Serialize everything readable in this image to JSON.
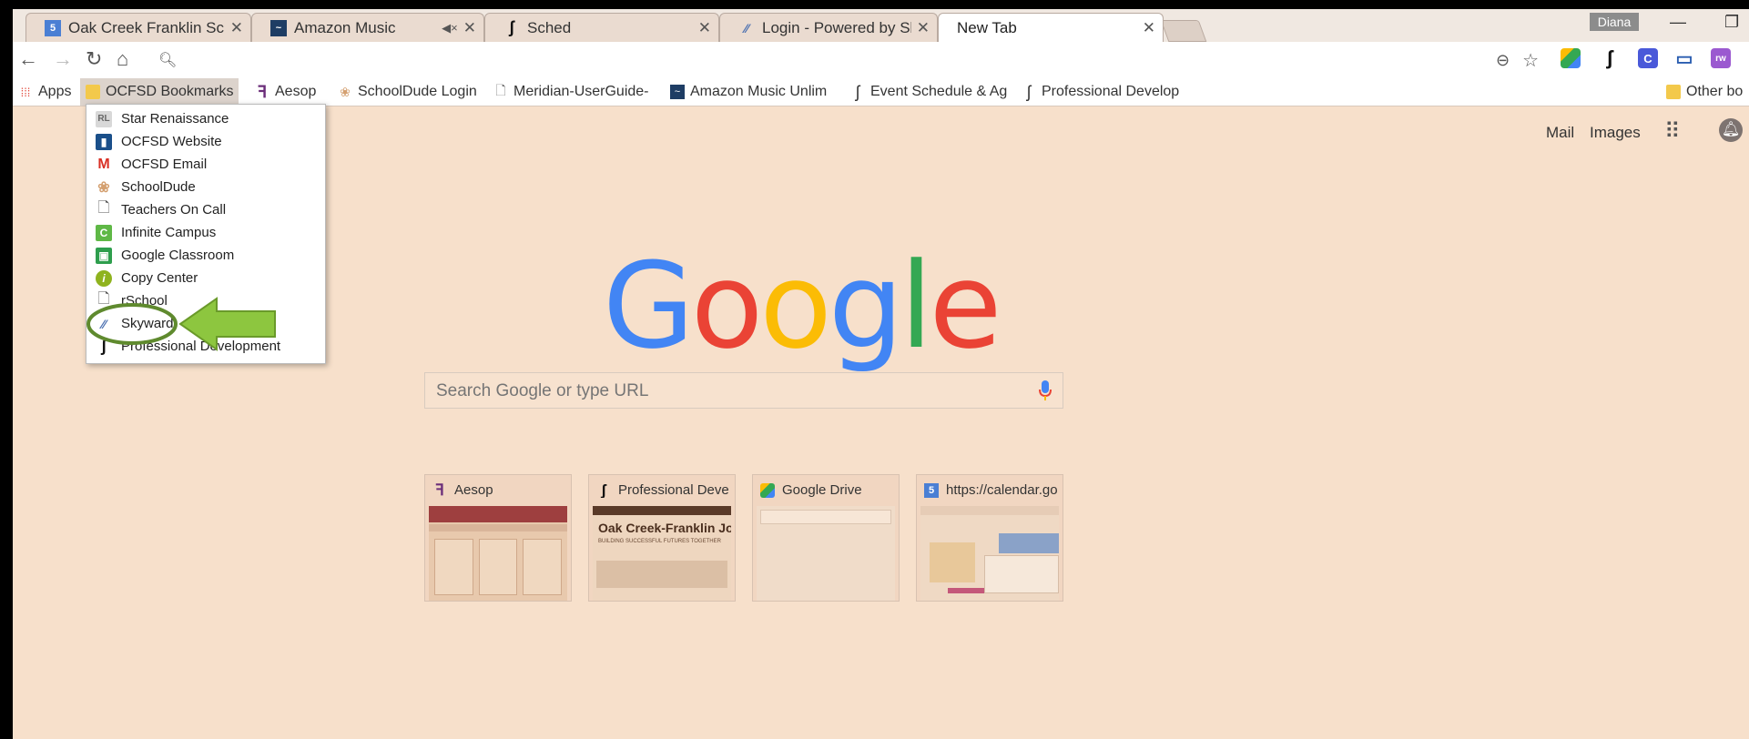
{
  "tabs": [
    {
      "title": "Oak Creek Franklin Schoo",
      "icon": "calendar-icon"
    },
    {
      "title": "Amazon Music",
      "icon": "amazon-music-icon",
      "extra": "◀× ✕"
    },
    {
      "title": "Sched",
      "icon": "sched-icon"
    },
    {
      "title": "Login - Powered by Skyw",
      "icon": "skyward-icon"
    },
    {
      "title": "New Tab",
      "icon": ""
    }
  ],
  "window": {
    "user": "Diana"
  },
  "omnibox": {
    "value": "",
    "placeholder": ""
  },
  "bookmarks": [
    {
      "label": "Apps"
    },
    {
      "label": "OCFSD Bookmarks"
    },
    {
      "label": "Aesop"
    },
    {
      "label": "SchoolDude Login"
    },
    {
      "label": "Meridian-UserGuide-"
    },
    {
      "label": "Amazon Music Unlim"
    },
    {
      "label": "Event Schedule & Ag"
    },
    {
      "label": "Professional Develop"
    },
    {
      "label": "Other bo"
    }
  ],
  "folder_items": [
    {
      "label": "Star Renaissance",
      "icon": "rl-icon",
      "glyph": "RL",
      "color": "#7a7a7a"
    },
    {
      "label": "OCFSD Website",
      "icon": "school-icon",
      "glyph": "▮",
      "color": "#1a4f8a"
    },
    {
      "label": "OCFSD Email",
      "icon": "gmail-icon",
      "glyph": "M",
      "color": "#d93025"
    },
    {
      "label": "SchoolDude",
      "icon": "schooldude-icon",
      "glyph": "❀",
      "color": "#e0b080"
    },
    {
      "label": "Teachers On Call",
      "icon": "page-icon",
      "glyph": "🗋",
      "color": "#ffffff"
    },
    {
      "label": "Infinite Campus",
      "icon": "infinite-campus-icon",
      "glyph": "C",
      "color": "#5fb846"
    },
    {
      "label": "Google Classroom",
      "icon": "classroom-icon",
      "glyph": "▣",
      "color": "#2e9e4d"
    },
    {
      "label": "Copy Center",
      "icon": "info-icon",
      "glyph": "i",
      "color": "#8fb31e"
    },
    {
      "label": "rSchool",
      "icon": "page-icon",
      "glyph": "🗋",
      "color": "#ffffff"
    },
    {
      "label": "Skyward",
      "icon": "skyward-icon",
      "glyph": "⁄⁄",
      "color": "#4a6fb0"
    },
    {
      "label": "Professional Development",
      "icon": "sched-icon",
      "glyph": "ʃ",
      "color": "#111111"
    }
  ],
  "ntp": {
    "mail": "Mail",
    "images": "Images",
    "logo": [
      "G",
      "o",
      "o",
      "g",
      "l",
      "e"
    ],
    "search_placeholder": "Search Google or type URL",
    "tiles": [
      {
        "title": "Aesop",
        "icon": "aesop-icon"
      },
      {
        "title": "Professional Develop",
        "icon": "sched-icon",
        "thumb_title": "Oak Creek-Franklin Joint School Distric",
        "thumb_sub": "BUILDING SUCCESSFUL FUTURES TOGETHER"
      },
      {
        "title": "Google Drive",
        "icon": "drive-icon"
      },
      {
        "title": "https://calendar.google",
        "icon": "calendar-icon"
      }
    ]
  },
  "colors": {
    "page_bg": "#f7e0cb",
    "arrow": "#8dc63f",
    "highlight_ring": "#5f8a2e",
    "google_blue": "#4285f4",
    "google_red": "#ea4335",
    "google_yellow": "#fbbc05",
    "google_green": "#34a853"
  }
}
